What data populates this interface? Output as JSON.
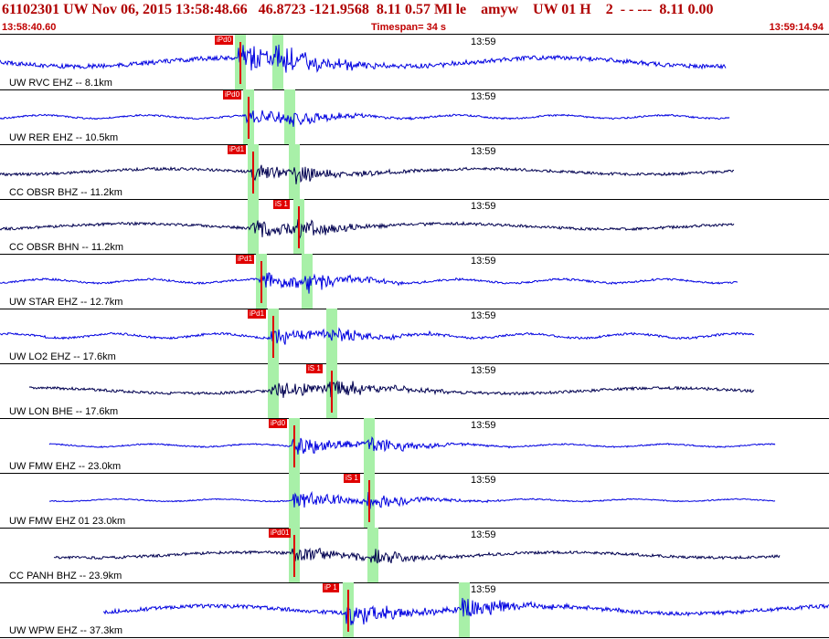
{
  "header": {
    "title": "61102301 UW Nov 06, 2015 13:58:48.66   46.8723 -121.9568  8.11 0.57 Ml le    amyw    UW 01 H    2  - - ---  8.11 0.00",
    "start_time": "13:58:40.60",
    "timespan": "Timespan=  34 s",
    "end_time": "13:59:14.94"
  },
  "time_marker": "13:59",
  "channels": [
    {
      "label": "UW RVC EHZ -- 8.1km",
      "p_pick": "iPd0",
      "s_pick": "",
      "trace_start": 0.0,
      "trace_end": 0.875,
      "p_frac": 0.29,
      "s_frac": 0.335,
      "color": "#0000e0",
      "amp": 0.8
    },
    {
      "label": "UW RER EHZ -- 10.5km",
      "p_pick": "iPd0",
      "s_pick": "",
      "trace_start": 0.0,
      "trace_end": 0.88,
      "p_frac": 0.3,
      "s_frac": 0.35,
      "color": "#0000e0",
      "amp": 0.3
    },
    {
      "label": "CC OBSR BHZ -- 11.2km",
      "p_pick": "iPd1",
      "s_pick": "",
      "trace_start": 0.0,
      "trace_end": 0.885,
      "p_frac": 0.305,
      "s_frac": 0.355,
      "color": "#000050",
      "amp": 0.5
    },
    {
      "label": "CC OBSR BHN -- 11.2km",
      "p_pick": "",
      "s_pick": "iS 1",
      "trace_start": 0.0,
      "trace_end": 0.885,
      "p_frac": 0.305,
      "s_frac": 0.36,
      "color": "#000050",
      "amp": 0.5
    },
    {
      "label": "UW STAR EHZ -- 12.7km",
      "p_pick": "iPd1",
      "s_pick": "",
      "trace_start": 0.0,
      "trace_end": 0.89,
      "p_frac": 0.315,
      "s_frac": 0.37,
      "color": "#0000e0",
      "amp": 0.35
    },
    {
      "label": "UW LO2 EHZ -- 17.6km",
      "p_pick": "iPd1",
      "s_pick": "",
      "trace_start": 0.0,
      "trace_end": 0.91,
      "p_frac": 0.33,
      "s_frac": 0.4,
      "color": "#0000e0",
      "amp": 0.4
    },
    {
      "label": "UW LON BHE -- 17.6km",
      "p_pick": "",
      "s_pick": "iS 1",
      "trace_start": 0.035,
      "trace_end": 0.91,
      "p_frac": 0.33,
      "s_frac": 0.4,
      "color": "#000050",
      "amp": 0.5
    },
    {
      "label": "UW FMW EHZ -- 23.0km",
      "p_pick": "iPd0",
      "s_pick": "",
      "trace_start": 0.06,
      "trace_end": 0.935,
      "p_frac": 0.355,
      "s_frac": 0.445,
      "color": "#0000e0",
      "amp": 0.25
    },
    {
      "label": "UW FMW EHZ 01 23.0km",
      "p_pick": "",
      "s_pick": "iS 1",
      "trace_start": 0.06,
      "trace_end": 0.935,
      "p_frac": 0.355,
      "s_frac": 0.445,
      "color": "#0000e0",
      "amp": 0.2
    },
    {
      "label": "CC PANH BHZ -- 23.9km",
      "p_pick": "iPd01",
      "s_pick": "",
      "trace_start": 0.065,
      "trace_end": 0.94,
      "p_frac": 0.355,
      "s_frac": 0.45,
      "color": "#000050",
      "amp": 0.5
    },
    {
      "label": "UW WPW EHZ -- 37.3km",
      "p_pick": "iP 1",
      "s_pick": "",
      "trace_start": 0.125,
      "trace_end": 1.0,
      "p_frac": 0.42,
      "s_frac": 0.56,
      "color": "#0000e0",
      "amp": 0.7
    }
  ]
}
